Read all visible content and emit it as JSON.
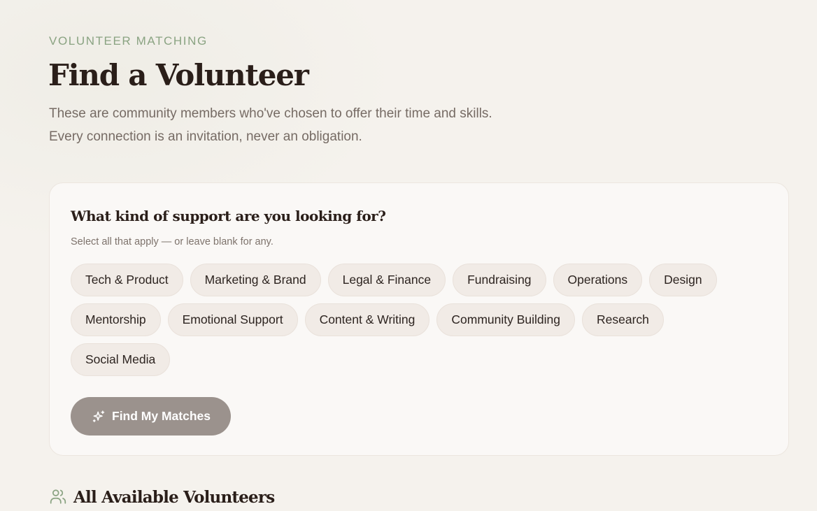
{
  "header": {
    "eyebrow": "VOLUNTEER MATCHING",
    "title": "Find a Volunteer",
    "subtitle": "These are community members who've chosen to offer their time and skills. Every connection is an invitation, never an obligation."
  },
  "support_card": {
    "title": "What kind of support are you looking for?",
    "hint": "Select all that apply — or leave blank for any.",
    "categories": [
      "Tech & Product",
      "Marketing & Brand",
      "Legal & Finance",
      "Fundraising",
      "Operations",
      "Design",
      "Mentorship",
      "Emotional Support",
      "Content & Writing",
      "Community Building",
      "Research",
      "Social Media"
    ],
    "button_label": "Find My Matches",
    "button_icon": "sparkles-icon"
  },
  "volunteers_section": {
    "title": "All Available Volunteers",
    "icon": "users-icon"
  },
  "colors": {
    "accent_green": "#8aa382",
    "chip_background": "#f1ebe6",
    "button_background": "#9b928d",
    "heading": "#2a1e19"
  }
}
